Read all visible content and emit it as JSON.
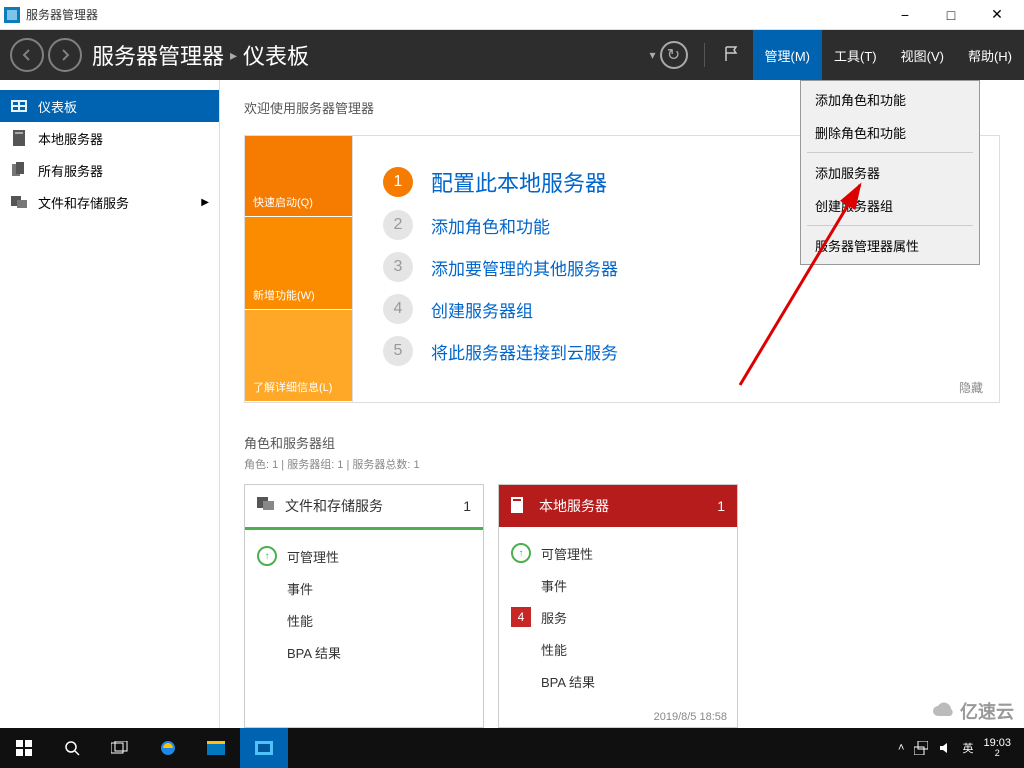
{
  "window": {
    "title": "服务器管理器"
  },
  "breadcrumb": {
    "app": "服务器管理器",
    "page": "仪表板"
  },
  "topmenu": {
    "manage": "管理(M)",
    "tools": "工具(T)",
    "view": "视图(V)",
    "help": "帮助(H)"
  },
  "dropdown": {
    "add_roles": "添加角色和功能",
    "remove_roles": "删除角色和功能",
    "add_server": "添加服务器",
    "create_group": "创建服务器组",
    "properties": "服务器管理器属性"
  },
  "sidebar": {
    "dashboard": "仪表板",
    "local": "本地服务器",
    "all": "所有服务器",
    "file": "文件和存储服务"
  },
  "welcome": {
    "heading": "欢迎使用服务器管理器",
    "tile1": "快速启动(Q)",
    "tile2": "新增功能(W)",
    "tile3": "了解详细信息(L)",
    "task1": "配置此本地服务器",
    "task2": "添加角色和功能",
    "task3": "添加要管理的其他服务器",
    "task4": "创建服务器组",
    "task5": "将此服务器连接到云服务",
    "hide": "隐藏"
  },
  "roles": {
    "heading": "角色和服务器组",
    "sub": "角色: 1 | 服务器组: 1 | 服务器总数: 1"
  },
  "card1": {
    "title": "文件和存储服务",
    "count": "1",
    "r1": "可管理性",
    "r2": "事件",
    "r3": "性能",
    "r4": "BPA 结果"
  },
  "card2": {
    "title": "本地服务器",
    "count": "1",
    "r1": "可管理性",
    "r2": "事件",
    "r3": "服务",
    "badge": "4",
    "r4": "性能",
    "r5": "BPA 结果",
    "time": "2019/8/5 18:58"
  },
  "taskbar": {
    "ime": "英",
    "clock": "19:03",
    "date": "2"
  },
  "watermark": "亿速云"
}
